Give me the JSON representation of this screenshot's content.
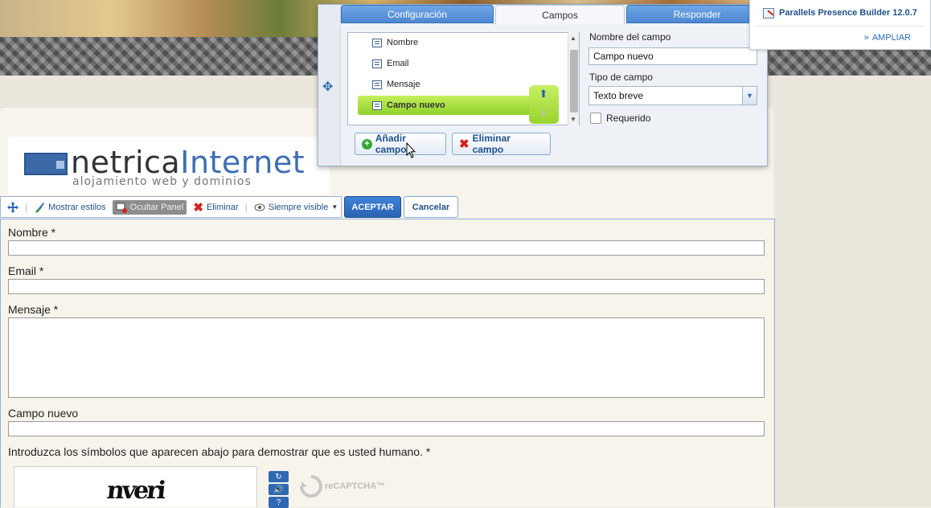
{
  "panel": {
    "tabs": [
      {
        "label": "Configuración",
        "active": false
      },
      {
        "label": "Campos",
        "active": true
      },
      {
        "label": "Responder",
        "active": false
      }
    ],
    "fields_list": [
      {
        "label": "Nombre"
      },
      {
        "label": "Email"
      },
      {
        "label": "Mensaje"
      },
      {
        "label": "Campo nuevo",
        "selected": true
      }
    ],
    "add_button": "Añadir campo",
    "remove_button": "Eliminar campo",
    "field_name_label": "Nombre del campo",
    "field_name_value": "Campo nuevo",
    "field_type_label": "Tipo de campo",
    "field_type_value": "Texto breve",
    "required_label": "Requerido",
    "required_checked": false
  },
  "product": {
    "name": "Parallels Presence Builder 12.0.7",
    "expand_label": "AMPLIAR"
  },
  "logo": {
    "name_part1": "netrica",
    "name_part2": "Internet",
    "tagline": "alojamiento web y dominios"
  },
  "toolbar": {
    "show_styles": "Mostrar estilos",
    "hide_panel": "Ocultar Panel",
    "delete": "Eliminar",
    "always_visible": "Siempre visible",
    "accept": "ACEPTAR",
    "cancel": "Cancelar"
  },
  "form": {
    "fields": [
      {
        "label": "Nombre *"
      },
      {
        "label": "Email *"
      },
      {
        "label": "Mensaje *"
      },
      {
        "label": "Campo nuevo"
      }
    ],
    "captcha_prompt": "Introduzca los símbolos que aparecen abajo para demostrar que es usted humano. *",
    "captcha_text": "nveri",
    "recaptcha_label": "reCAPTCHA™"
  },
  "colors": {
    "accent": "#2f69b3",
    "selection": "#8fd12a",
    "danger": "#d42020"
  }
}
